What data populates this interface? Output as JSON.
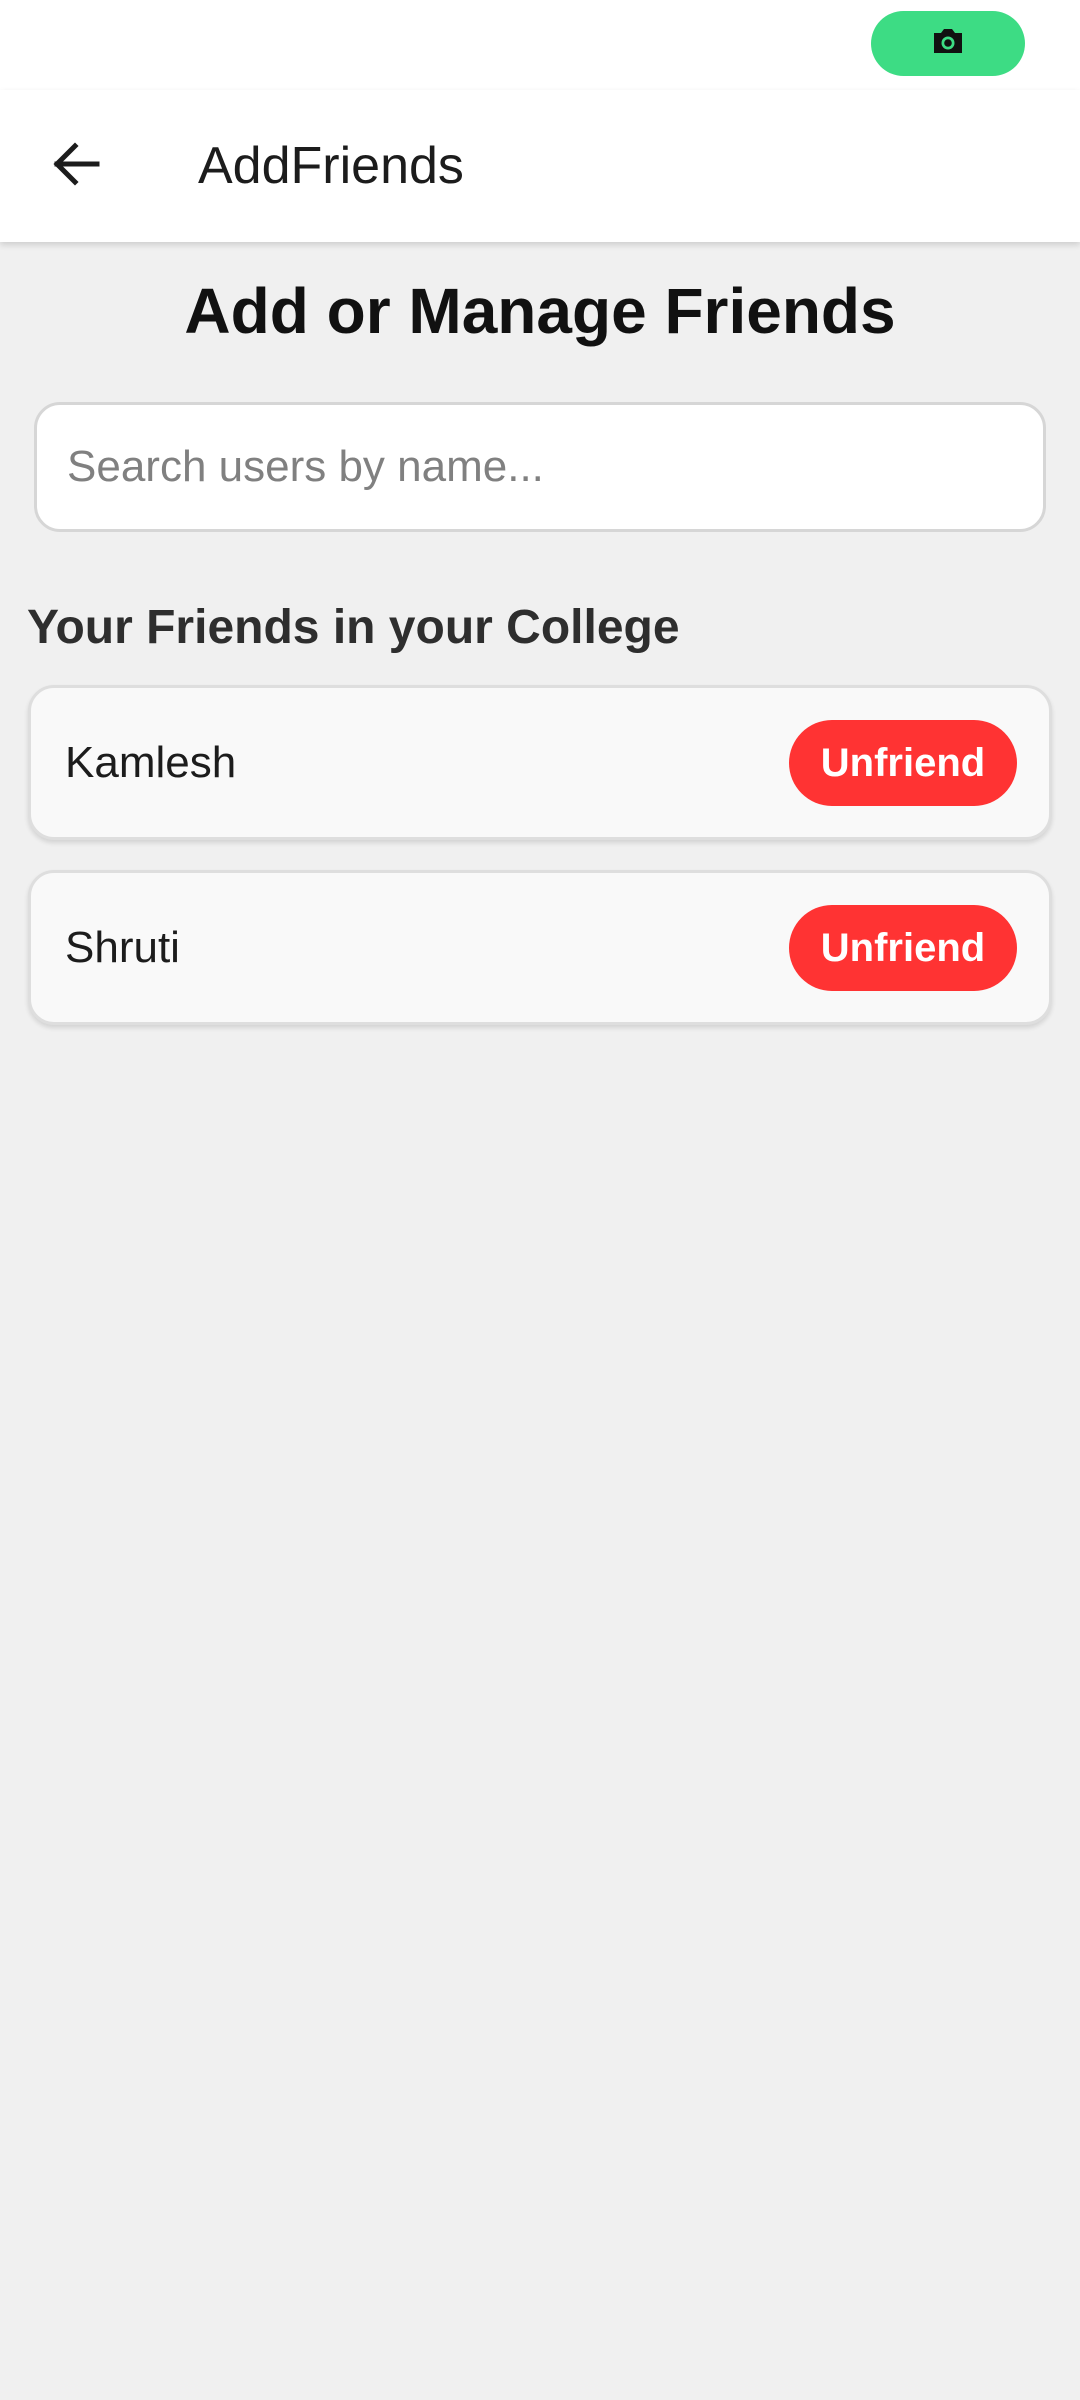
{
  "status_bar": {
    "camera_icon": "camera-icon",
    "camera_pill_color": "#3ddc84"
  },
  "app_bar": {
    "back_icon": "arrow-left-icon",
    "title": "AddFriends"
  },
  "main": {
    "heading": "Add or Manage Friends",
    "search": {
      "placeholder": "Search users by name...",
      "value": ""
    },
    "section_title": "Your Friends in your College",
    "friends": [
      {
        "name": "Kamlesh",
        "action_label": "Unfriend"
      },
      {
        "name": "Shruti",
        "action_label": "Unfriend"
      }
    ],
    "action_color": "#ff3333"
  }
}
